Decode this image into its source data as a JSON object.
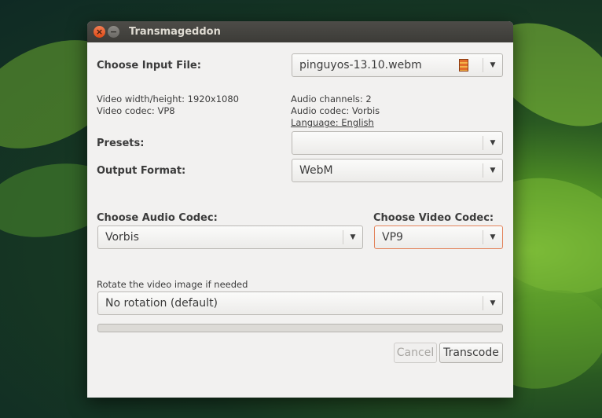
{
  "window": {
    "title": "Transmageddon",
    "close_glyph": "×",
    "minimize_glyph": "−"
  },
  "input": {
    "label": "Choose Input File:",
    "file": "pinguyos-13.10.webm",
    "icon": "film-icon"
  },
  "video_info": {
    "size": "Video width/height: 1920x1080",
    "codec": "Video codec: VP8"
  },
  "audio_info": {
    "channels": "Audio channels: 2",
    "codec": "Audio codec: Vorbis",
    "language": "Language: English"
  },
  "presets": {
    "label": "Presets:",
    "value": ""
  },
  "output_format": {
    "label": "Output Format:",
    "value": "WebM"
  },
  "audio_codec": {
    "label": "Choose Audio Codec:",
    "value": "Vorbis"
  },
  "video_codec": {
    "label": "Choose Video Codec:",
    "value": "VP9"
  },
  "rotate": {
    "label": "Rotate the video image if needed",
    "value": "No rotation (default)"
  },
  "progress": {
    "fraction": 0
  },
  "buttons": {
    "cancel": "Cancel",
    "transcode": "Transcode"
  },
  "colors": {
    "focus_border": "#e3825a",
    "titlebar": "#3c3b37",
    "close_button": "#df4a16"
  }
}
